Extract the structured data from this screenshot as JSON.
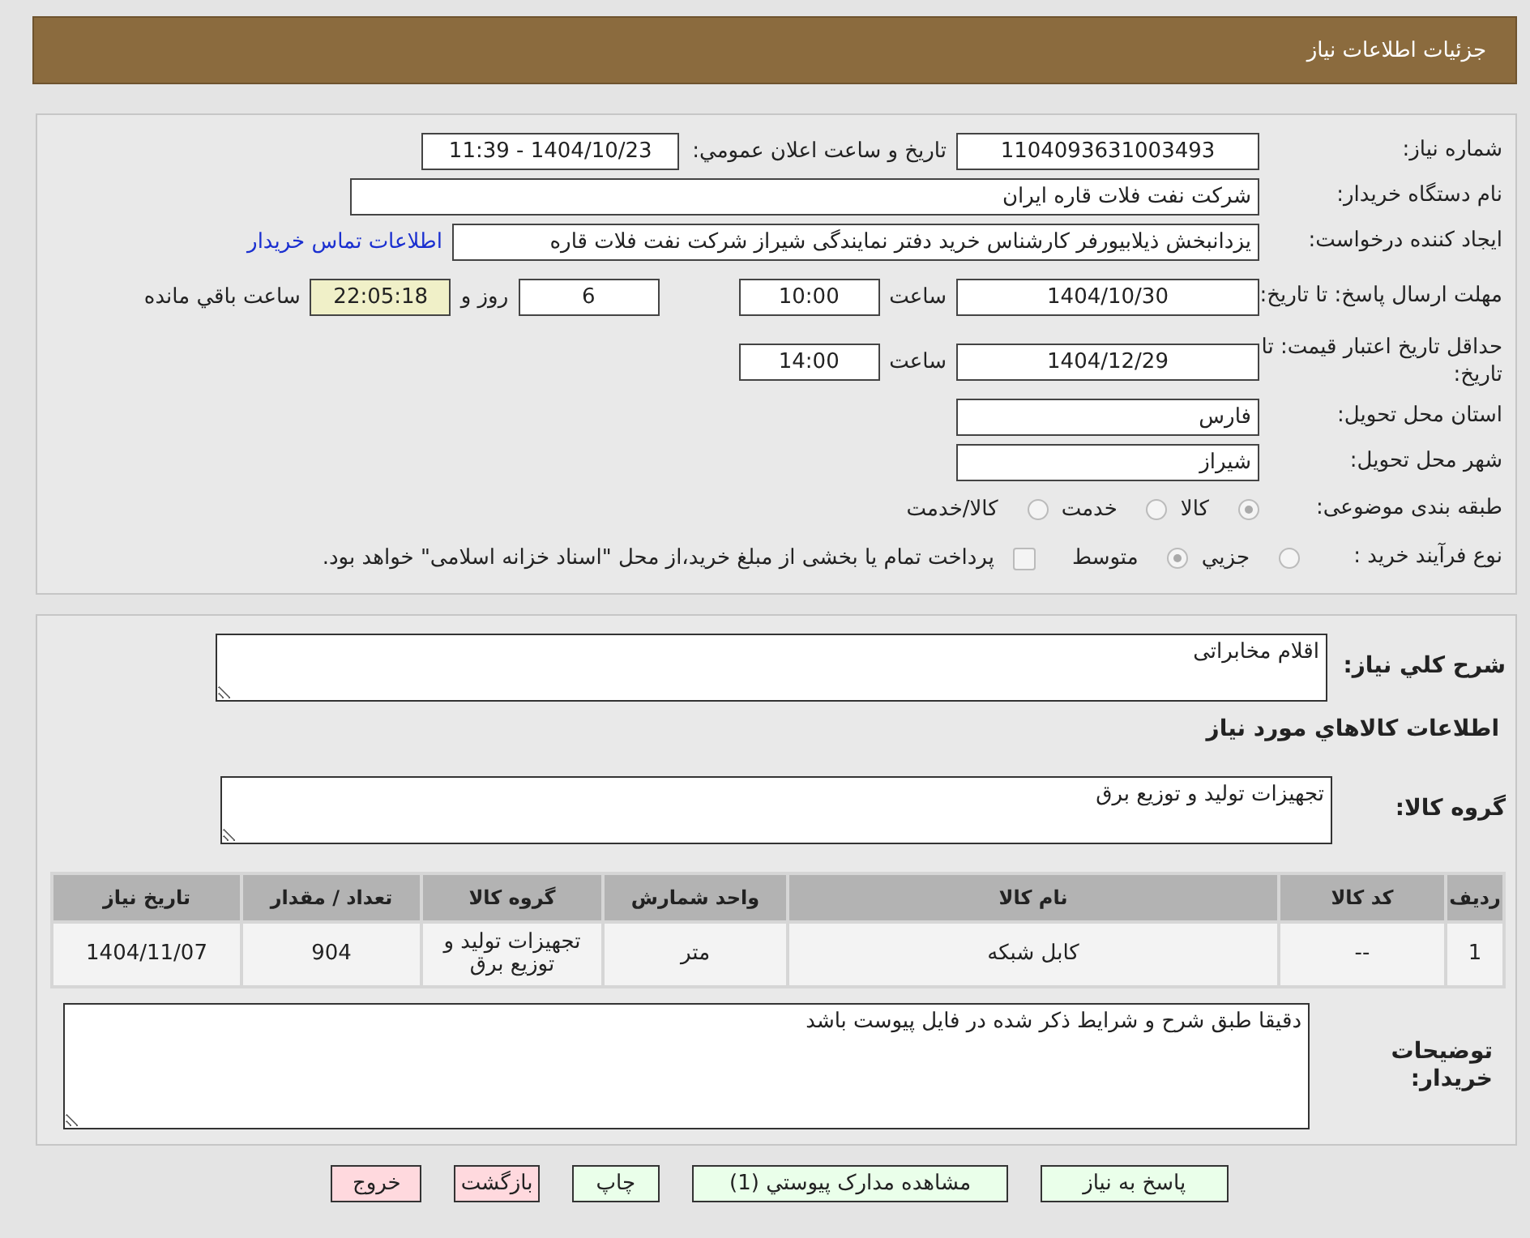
{
  "header": {
    "title": "جزئيات اطلاعات نياز"
  },
  "need_number": {
    "label": "شماره نياز:",
    "value": "1104093631003493"
  },
  "announce": {
    "label": "تاريخ و ساعت اعلان عمومي:",
    "value": "1404/10/23 - 11:39"
  },
  "buyer": {
    "label": "نام دستگاه خريدار:",
    "value": "شركت نفت فلات قاره ايران"
  },
  "requester": {
    "label": "ايجاد كننده درخواست:",
    "value": "يزدانبخش ذيلابيورفر كارشناس خريد دفتر نمايندگی شيراز شركت نفت فلات قاره",
    "link": "اطلاعات تماس خريدار"
  },
  "deadline": {
    "label": "مهلت ارسال پاسخ: تا تاريخ:",
    "date": "1404/10/30",
    "time_label": "ساعت",
    "time": "10:00",
    "days": "6",
    "days_label": "روز و",
    "remaining": "22:05:18",
    "remaining_label": "ساعت باقي مانده"
  },
  "validity": {
    "label": "حداقل تاريخ اعتبار قيمت: تا تاريخ:",
    "date": "1404/12/29",
    "time_label": "ساعت",
    "time": "14:00"
  },
  "province": {
    "label": "استان محل تحويل:",
    "value": "فارس"
  },
  "city": {
    "label": "شهر محل تحويل:",
    "value": "شيراز"
  },
  "category": {
    "label": "طبقه بندی موضوعی:",
    "options": [
      {
        "label": "كالا",
        "selected": true
      },
      {
        "label": "خدمت",
        "selected": false
      },
      {
        "label": "كالا/خدمت",
        "selected": false
      }
    ]
  },
  "purchase_type": {
    "label": "نوع فرآيند خريد :",
    "options": [
      {
        "label": "جزيي",
        "selected": false
      },
      {
        "label": "متوسط",
        "selected": true
      }
    ],
    "payment": {
      "label": "پرداخت تمام يا بخشی از مبلغ خريد،از محل \"اسناد خزانه اسلامی\" خواهد بود.",
      "checked": false
    }
  },
  "description": {
    "label": "شرح كلي نياز:",
    "value": "اقلام مخابراتی"
  },
  "goods_title": "اطلاعات كالاهاي مورد نياز",
  "goods_group": {
    "label": "گروه كالا:",
    "value": "تجهيزات توليد و توزيع برق"
  },
  "table": {
    "columns": [
      "رديف",
      "كد كالا",
      "نام كالا",
      "واحد شمارش",
      "گروه كالا",
      "تعداد / مقدار",
      "تاريخ نياز"
    ],
    "rows": [
      [
        "1",
        "--",
        "كابل شبكه",
        "متر",
        "تجهيزات توليد و توزيع برق",
        "904",
        "1404/11/07"
      ]
    ]
  },
  "buyer_notes": {
    "label": "توضيحات خريدار:",
    "value": "دقيقا طبق شرح و شرايط ذكر شده در فايل پيوست باشد"
  },
  "buttons": [
    {
      "label": "پاسخ به نياز",
      "kind": "normal"
    },
    {
      "label": "مشاهده مدارک پيوستي (1)",
      "kind": "normal"
    },
    {
      "label": "چاپ",
      "kind": "normal"
    },
    {
      "label": "بازگشت",
      "kind": "danger"
    },
    {
      "label": "خروج",
      "kind": "danger"
    }
  ]
}
